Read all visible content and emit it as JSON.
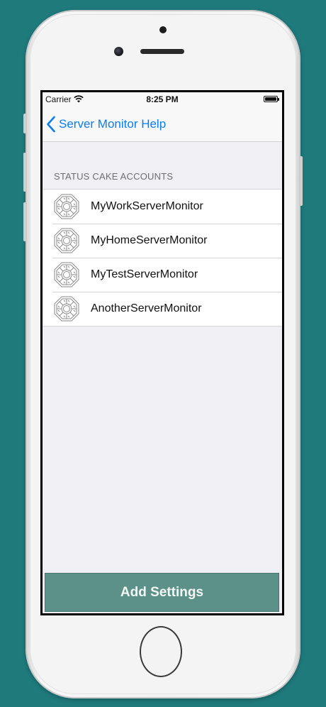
{
  "status_bar": {
    "carrier": "Carrier",
    "time": "8:25 PM"
  },
  "nav_bar": {
    "back_label": "Server Monitor Help"
  },
  "accounts_section": {
    "header": "STATUS CAKE ACCOUNTS",
    "items": [
      {
        "label": "MyWorkServerMonitor",
        "icon": "server-monitor-icon"
      },
      {
        "label": "MyHomeServerMonitor",
        "icon": "server-monitor-icon"
      },
      {
        "label": "MyTestServerMonitor",
        "icon": "server-monitor-icon"
      },
      {
        "label": "AnotherServerMonitor",
        "icon": "server-monitor-icon"
      }
    ]
  },
  "footer": {
    "add_settings_label": "Add Settings"
  },
  "colors": {
    "background": "#1f7a7c",
    "ios_blue": "#0a7cf0",
    "add_button": "#5b9188",
    "table_background": "#efeff4"
  }
}
